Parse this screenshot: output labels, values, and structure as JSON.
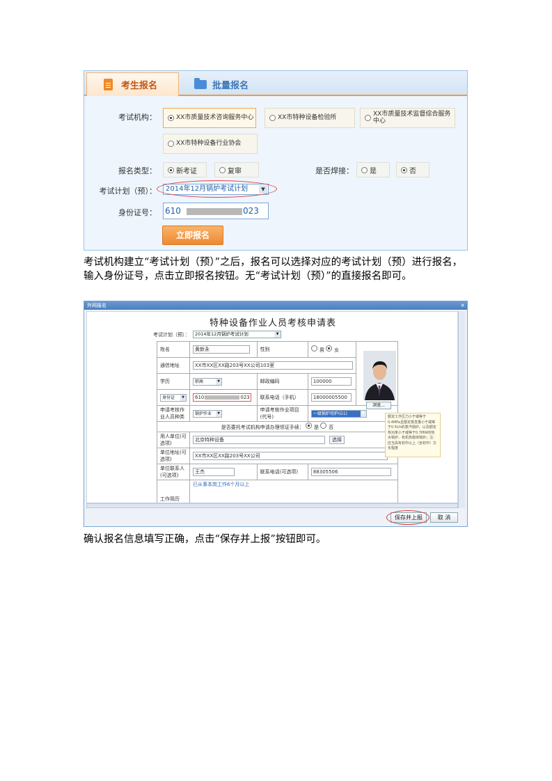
{
  "shot1": {
    "tabs": [
      "考生报名",
      "批量报名"
    ],
    "institution_label": "考试机构：",
    "institutions": [
      "XX市质量技术咨询服务中心",
      "XX市特种设备检验所",
      "XX市质量技术监督综合服务中心",
      "XX市特种设备行业协会"
    ],
    "type_label": "报名类型：",
    "types": [
      "新考证",
      "复审"
    ],
    "weld_label": "是否焊接：",
    "weld_options": [
      "是",
      "否"
    ],
    "plan_label": "考试计划（预）：",
    "plan_value": "2014年12月锅炉考试计划",
    "id_label": "身份证号：",
    "id_prefix": "610",
    "id_suffix": "023",
    "apply_button": "立即报名"
  },
  "para1": "考试机构建立“考试计划（预）”之后，报名可以选择对应的考试计划（预）进行报名，输入身份证号，点击立即报名按钮。无“考试计划（预）”的直接报名即可。",
  "shot2": {
    "dialog_title": "外网报名",
    "close_glyph": "×",
    "form_title": "特种设备作业人员考核申请表",
    "plan_label": "考试计划（预）：",
    "plan_value": "2014年12月锅炉考试计划",
    "name_label": "姓名",
    "name_value": "黄新永",
    "gender_label": "性别",
    "gender_options": [
      "男",
      "女"
    ],
    "address_label": "通信地址",
    "address_value": "XX市XX区XX路203号XX公司103室",
    "edu_label": "学历",
    "edu_value": "职高",
    "postcode_label": "邮政编码",
    "postcode_value": "100000",
    "idtype_value": "身份证",
    "id_prefix": "610",
    "id_suffix": "023",
    "phone_label": "联系电话（手机）",
    "phone_value": "18000005500",
    "browse_button": "浏览...",
    "category_label": "申请考核作业人员种类",
    "category_value": "锅炉作业",
    "item_label": "申请考核作业项目(代号)",
    "item_value": "一级锅炉司炉(G1)",
    "tooltip": "额定工作压力小于或等于0.4MPa且额定蒸发量小于或等于0.5t/h的蒸汽锅炉，以及额定热功率小于或等于0.7MW的热水锅炉、有机热载体锅炉；注：应当具有初中以上（含初中）文化程度",
    "entrust_label": "是否委托考试机构申请办理领证手续：",
    "entrust_options": [
      "是",
      "否"
    ],
    "employer_label": "用人单位(可选项)",
    "employer_value": "北京特种设备",
    "choose_button": "选择",
    "unit_addr_label": "单位地址(可选项)",
    "unit_addr_value": "XX市XX区XX路203号XX公司",
    "contact_label": "单位联系人(可选项)",
    "contact_value": "王杰",
    "contact_phone_label": "联系电话(可选项)",
    "contact_phone_value": "88305506",
    "work_label": "工作简历",
    "work_value": "已从事本岗工作6个月以上",
    "save_button": "保存并上报",
    "cancel_button": "取 消"
  },
  "para2": "确认报名信息填写正确，点击“保存并上报”按钮即可。"
}
